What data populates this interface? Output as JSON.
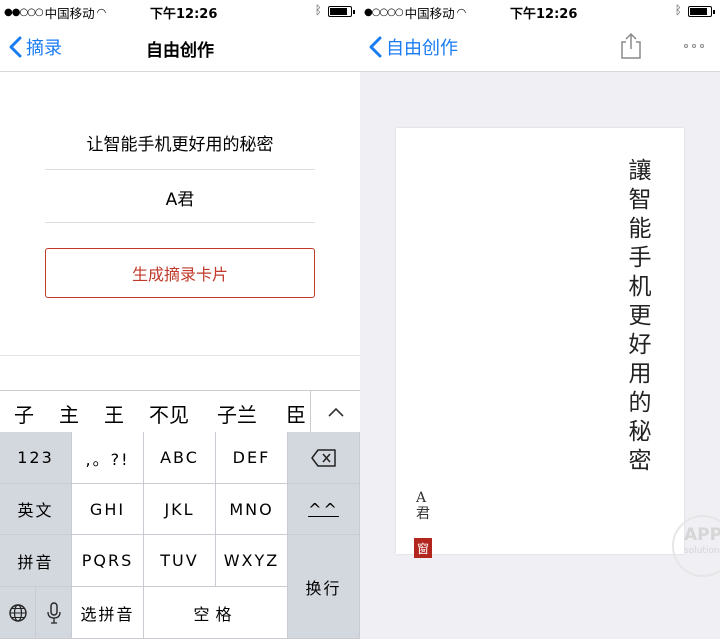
{
  "left": {
    "status": {
      "carrier": "中国移动",
      "time": "下午12:26"
    },
    "nav": {
      "back_label": "摘录",
      "title": "自由创作"
    },
    "form": {
      "title_value": "让智能手机更好用的秘密",
      "author_value": "A君",
      "generate_label": "生成摘录卡片"
    },
    "candidates": [
      "子",
      "主",
      "王",
      "不见",
      "子兰",
      "臣"
    ],
    "keyboard": {
      "rows": [
        [
          "123",
          ",。?!",
          "ABC",
          "DEF"
        ],
        [
          "英文",
          "GHI",
          "JKL",
          "MNO",
          "^^"
        ],
        [
          "拼音",
          "PQRS",
          "TUV",
          "WXYZ"
        ]
      ],
      "pinyin_select": "选拼音",
      "space": "空格",
      "enter": "换行"
    }
  },
  "right": {
    "status": {
      "carrier": "中国移动",
      "time": "下午12:26"
    },
    "nav": {
      "back_label": "自由创作"
    },
    "card": {
      "vertical_title": "讓智能手机更好用的秘密",
      "author_line1": "A",
      "author_line2": "君",
      "seal_text": "窗"
    },
    "watermark": {
      "line1": "APP",
      "line2": "solution"
    }
  },
  "colors": {
    "accent_blue": "#1a7cf3",
    "accent_red": "#c0392b",
    "seal_red": "#b3261e"
  }
}
